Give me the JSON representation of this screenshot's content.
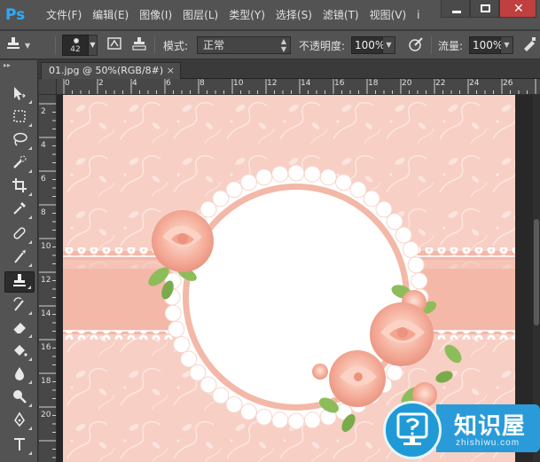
{
  "app": {
    "logo": "Ps"
  },
  "menu": [
    "文件(F)",
    "编辑(E)",
    "图像(I)",
    "图层(L)",
    "类型(Y)",
    "选择(S)",
    "滤镜(T)",
    "视图(V)",
    "i"
  ],
  "options": {
    "brush_size": "42",
    "mode_label": "模式:",
    "mode_value": "正常",
    "opacity_label": "不透明度:",
    "opacity_value": "100%",
    "flow_label": "流量:",
    "flow_value": "100%"
  },
  "document": {
    "tab_title": "01.jpg @ 50%(RGB/8#)",
    "tab_close": "×",
    "h_ruler": [
      "0",
      "2",
      "4",
      "6",
      "8",
      "10",
      "12",
      "14",
      "16",
      "18",
      "20",
      "22",
      "24",
      "26"
    ],
    "v_ruler": [
      "2",
      "4",
      "6",
      "8",
      "10",
      "12",
      "14",
      "16",
      "18",
      "20"
    ]
  },
  "tools": [
    "move-tool",
    "marquee-tool",
    "lasso-tool",
    "quick-selection-tool",
    "crop-tool",
    "eyedropper-tool",
    "healing-brush-tool",
    "brush-tool",
    "clone-stamp-tool",
    "history-brush-tool",
    "eraser-tool",
    "paint-bucket-tool",
    "blur-tool",
    "dodge-tool",
    "pen-tool",
    "type-tool"
  ],
  "colors": {
    "canvas_pink": "#f7cfc4",
    "band_pink": "#f3b8a8",
    "rose": "#f4a48f",
    "leaf": "#8dbd5a",
    "accent_blue": "#1f9ad6"
  },
  "watermark": {
    "name": "知识屋",
    "url": "zhishiwu.com"
  }
}
